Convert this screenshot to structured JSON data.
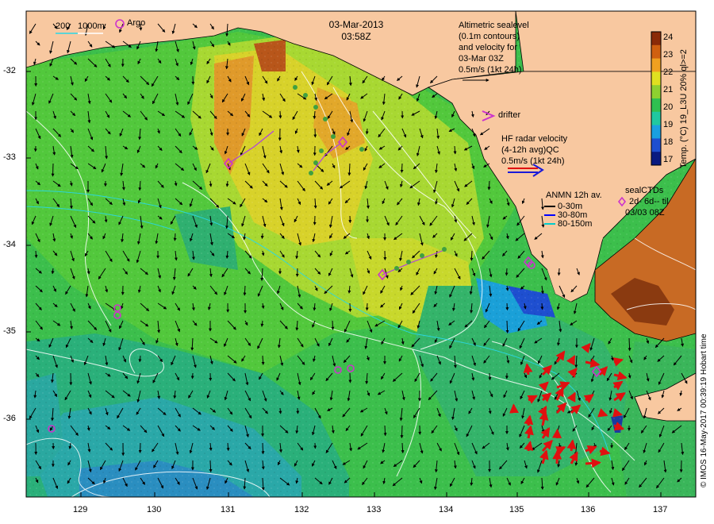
{
  "header": {
    "date": "03-Mar-2013",
    "time": "03:58Z"
  },
  "scale_bar": {
    "label1": "200",
    "label2": "1000m"
  },
  "argo_legend": {
    "label": "Argo",
    "color": "#cc33cc"
  },
  "altimetry_legend": {
    "line1": "Altimetric sealevel",
    "line2": "(0.1m contours)",
    "line3": "and velocity for",
    "line4": "03-Mar 03Z",
    "line5": "0.5m/s (1kt 24h)"
  },
  "drifter_legend": {
    "label": "drifter"
  },
  "hf_radar_legend": {
    "line1": "HF radar velocity",
    "line2": "(4-12h avg)QC",
    "line3": "0.5m/s (1kt 24h)"
  },
  "anmn_legend": {
    "title": "ANMN 12h av.",
    "item1": "0-30m",
    "item1_color": "#000000",
    "item2": "30-80m",
    "item2_color": "#0000ff",
    "item3": "80-150m",
    "item3_color": "#00cccc"
  },
  "sealctd_legend": {
    "title": "sealCTDs",
    "line1": "2d- 6d-- til",
    "line2": "03/03 08Z"
  },
  "colorbar": {
    "label": "Temp. (°C) 19_L3U 20% ql>=2",
    "ticks": [
      "24",
      "23",
      "22",
      "21",
      "20",
      "19",
      "18",
      "17"
    ],
    "colors": [
      "#0a1a80",
      "#1e4fd0",
      "#1aa0e0",
      "#20c8a0",
      "#30c050",
      "#8ed030",
      "#e0e020",
      "#f0a020",
      "#d06010",
      "#8a2a08"
    ]
  },
  "axes": {
    "x_ticks": [
      "129",
      "130",
      "131",
      "132",
      "133",
      "134",
      "135",
      "136",
      "137"
    ],
    "y_ticks": [
      "-32",
      "-33",
      "-34",
      "-35",
      "-36"
    ]
  },
  "credit": {
    "text": "© IMOS 16-May-2017 00:39:19 Hobart time"
  }
}
